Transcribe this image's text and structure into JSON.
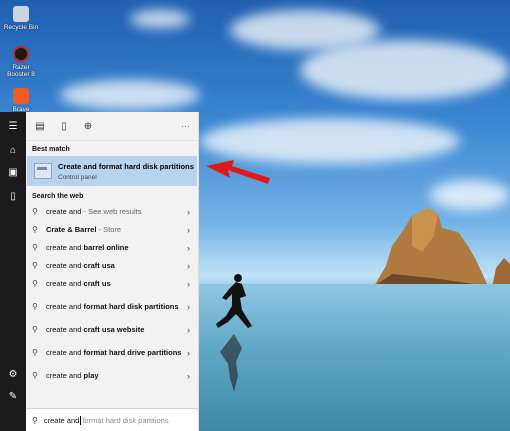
{
  "desktop": {
    "icons": [
      {
        "label": "Recycle Bin",
        "icon": "recycle-bin-icon",
        "color": "#c9d6e0"
      },
      {
        "label": "Razer Booster 8",
        "icon": "razer-icon",
        "color": "#c4291e"
      },
      {
        "label": "Brave",
        "icon": "brave-icon",
        "color": "#f05a24"
      }
    ]
  },
  "taskbar": {
    "icons": [
      "hamburger-menu-icon",
      "home-icon",
      "documents-icon",
      "phone-icon",
      "settings-gear-icon",
      "feedback-icon"
    ]
  },
  "search_panel": {
    "tool_icons": [
      "apps-icon",
      "document-icon",
      "web-globe-icon"
    ],
    "more_label": "···",
    "best_match_heading": "Best match",
    "best_match": {
      "title": "Create and format hard disk partitions",
      "subtitle": "Control panel",
      "icon": "disk-partition-icon"
    },
    "web_heading": "Search the web",
    "web_results": [
      {
        "prefix": "create and",
        "bold": "",
        "suffix": " - See web results"
      },
      {
        "prefix": "",
        "bold": "Crate & Barrel",
        "suffix": " - Store"
      },
      {
        "prefix": "create and ",
        "bold": "barrel online",
        "suffix": ""
      },
      {
        "prefix": "create and ",
        "bold": "craft usa",
        "suffix": ""
      },
      {
        "prefix": "create and ",
        "bold": "craft us",
        "suffix": ""
      },
      {
        "prefix": "create and ",
        "bold": "format hard disk partitions",
        "suffix": ""
      },
      {
        "prefix": "create and ",
        "bold": "craft usa website",
        "suffix": ""
      },
      {
        "prefix": "create and ",
        "bold": "format hard drive partitions",
        "suffix": ""
      },
      {
        "prefix": "create and ",
        "bold": "play",
        "suffix": ""
      }
    ],
    "search_value": "create and",
    "search_suggestion": "format hard disk partitions"
  },
  "colors": {
    "highlight": "#b8d3ee",
    "arrow": "#e0191b",
    "taskbar": "#1b1b1b"
  }
}
